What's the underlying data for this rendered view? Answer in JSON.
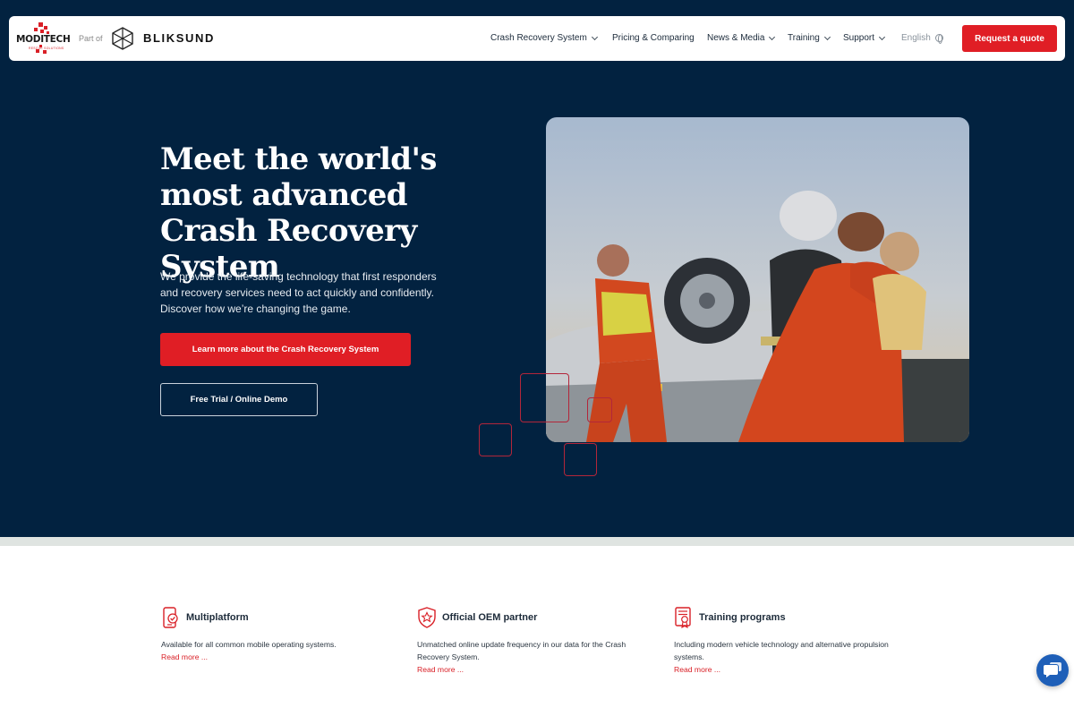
{
  "header": {
    "brand": {
      "name": "MODITECH",
      "tagline": "RESCUE SOLUTIONS"
    },
    "part_of": "Part of",
    "partner_brand": "BLIKSUND",
    "nav": [
      {
        "label": "Crash Recovery System",
        "has_dropdown": true
      },
      {
        "label": "Pricing & Comparing",
        "has_dropdown": false
      },
      {
        "label": "News & Media",
        "has_dropdown": true
      },
      {
        "label": "Training",
        "has_dropdown": true
      },
      {
        "label": "Support",
        "has_dropdown": true
      }
    ],
    "language": "English",
    "cta": "Request a quote"
  },
  "hero": {
    "title": "Meet the world's most advanced Crash Recovery System",
    "subtitle": "We provide the life-saving technology that first responders and recovery services need to act quickly and confidently. Discover how we’re changing the game.",
    "primary_button": "Learn more about the Crash Recovery System",
    "secondary_button": "Free Trial / Online Demo"
  },
  "features": [
    {
      "icon": "phone-check-icon",
      "title": "Multiplatform",
      "description": "Available for all common mobile operating systems.",
      "link": "Read more ..."
    },
    {
      "icon": "star-shield-icon",
      "title": "Official OEM partner",
      "description": "Unmatched online update frequency in our data for the Crash Recovery System.",
      "link": "Read more ..."
    },
    {
      "icon": "certificate-icon",
      "title": "Training programs",
      "description": "Including modern vehicle technology and alternative propulsion systems.",
      "link": "Read more ..."
    }
  ],
  "colors": {
    "navy": "#022240",
    "accent_red": "#e01e25",
    "chat_blue": "#1e5fb8"
  }
}
